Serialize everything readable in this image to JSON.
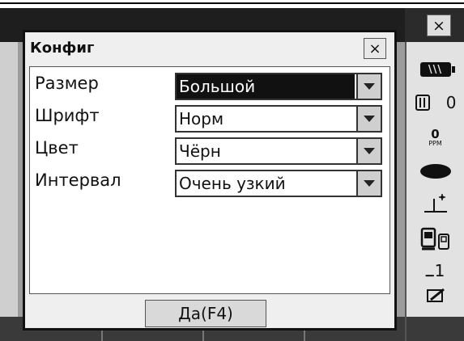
{
  "window": {
    "close_glyph": "×"
  },
  "dialog": {
    "title": "Конфиг",
    "close_glyph": "×",
    "rows": [
      {
        "label": "Размер",
        "value": "Большой",
        "selected": true
      },
      {
        "label": "Шрифт",
        "value": "Норм",
        "selected": false
      },
      {
        "label": "Цвет",
        "value": "Чёрн",
        "selected": false
      },
      {
        "label": "Интервал",
        "value": "Очень узкий",
        "selected": false
      }
    ],
    "ok_button": "Да(F4)"
  },
  "status": {
    "battery_glyph": "\\\\\\",
    "distance_value": "0",
    "ppm_value": "0",
    "ppm_unit": "PPM",
    "memory_value": "1"
  },
  "colors": {
    "screen_gray": "#9c9c9c",
    "selection": "#111111",
    "dialog_bg": "#efefef"
  }
}
